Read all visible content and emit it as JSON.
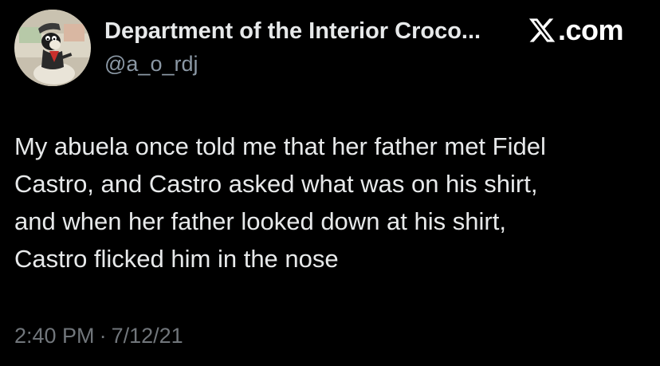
{
  "author": {
    "display_name": "Department of the Interior Croco...",
    "handle": "@a_o_rdj",
    "avatar_icon": "cartoon-character-avatar"
  },
  "brand": {
    "icon": "x-logo-icon",
    "label": "X.com",
    "suffix": ".com"
  },
  "tweet": {
    "lines": [
      "My abuela once told me that her father met Fidel",
      "Castro, and Castro asked what was on his shirt,",
      "and when her father looked down at his shirt,",
      "Castro flicked him in the nose"
    ]
  },
  "meta": {
    "time": "2:40 PM",
    "separator": "·",
    "date": "7/12/21"
  },
  "colors": {
    "background": "#000000",
    "primary_text": "#e7e9ea",
    "secondary_text": "#71767b",
    "handle_text": "#8b98a5"
  }
}
